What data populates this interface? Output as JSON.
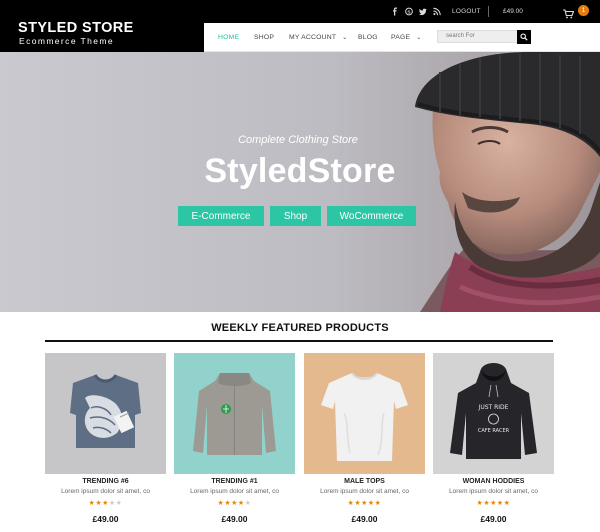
{
  "topbar": {
    "social_icons": [
      "facebook-icon",
      "skype-icon",
      "twitter-icon",
      "rss-icon"
    ],
    "logout_label": "LOGOUT",
    "cart_total": "£49.00",
    "cart_count": "1",
    "accent_color": "#e57d12"
  },
  "header": {
    "brand_name": "STYLED STORE",
    "brand_tagline": "Ecommerce Theme",
    "nav": [
      {
        "label": "HOME",
        "active": true
      },
      {
        "label": "SHOP",
        "active": false
      },
      {
        "label": "MY ACCOUNT",
        "active": false
      },
      {
        "label": "BLOG",
        "active": false
      },
      {
        "label": "PAGE",
        "active": false
      }
    ],
    "search_placeholder": "search For"
  },
  "hero": {
    "subtitle": "Complete Clothing Store",
    "title": "StyledStore",
    "buttons": [
      "E-Commerce",
      "Shop",
      "WoCommerce"
    ],
    "button_color": "#2cc6a4"
  },
  "featured": {
    "title": "WEEKLY FEATURED PRODUCTS",
    "products": [
      {
        "name": "TRENDING #6",
        "desc": "Lorem ipsum dolor sit amet, co",
        "rating": 3,
        "price": "£49.00"
      },
      {
        "name": "TRENDING #1",
        "desc": "Lorem ipsum dolor sit amet, co",
        "rating": 4,
        "price": "£49.00"
      },
      {
        "name": "MALE TOPS",
        "desc": "Lorem ipsum dolor sit amet, co",
        "rating": 5,
        "price": "£49.00"
      },
      {
        "name": "WOMAN HODDIES",
        "desc": "Lorem ipsum dolor sit amet, co",
        "rating": 5,
        "price": "£49.00"
      }
    ],
    "rating_max": 5,
    "star_color": "#e08a12"
  }
}
